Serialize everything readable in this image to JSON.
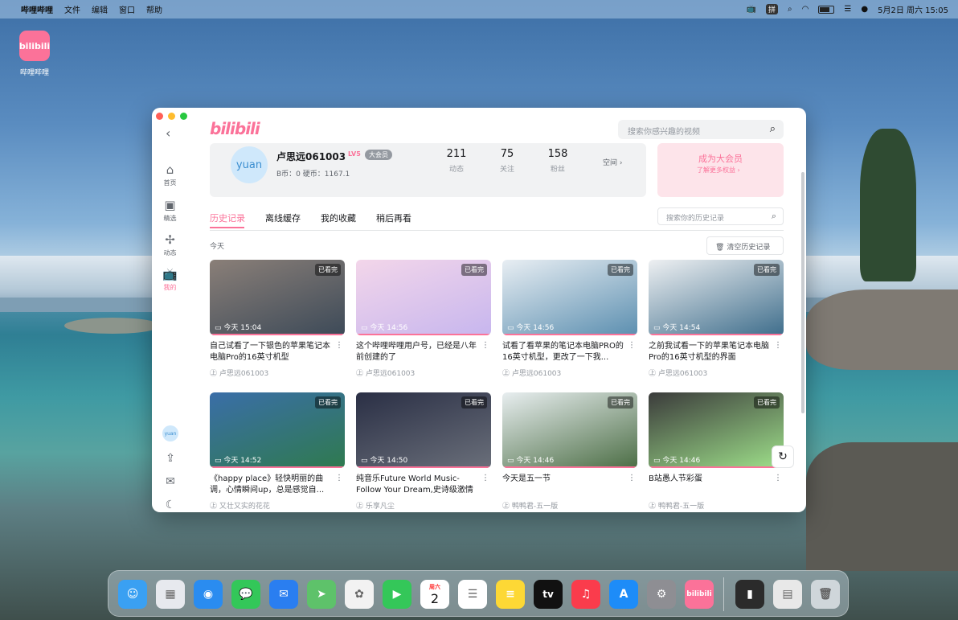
{
  "menubar": {
    "app": "哔哩哔哩",
    "items": [
      "文件",
      "编辑",
      "窗口",
      "帮助"
    ],
    "ime": "拼",
    "datetime": "5月2日 周六 15:05"
  },
  "desktop": {
    "icon_label": "哔哩哔哩",
    "icon_text": "bilibili"
  },
  "app": {
    "logo": "bilibili",
    "search_placeholder": "搜索你感兴趣的视频",
    "sidebar": [
      {
        "icon": "home-icon",
        "label": "首页"
      },
      {
        "icon": "bookmark-icon",
        "label": "精选"
      },
      {
        "icon": "pinwheel-icon",
        "label": "动态"
      },
      {
        "icon": "tv-icon",
        "label": "我的",
        "active": true
      }
    ],
    "sidebar_avatar": "yuan",
    "profile": {
      "avatar": "yuan",
      "name": "卢思远061003",
      "level": "LV5",
      "vip": "大会员",
      "coins": "B币：0   硬币：1167.1",
      "stats": [
        {
          "n": "211",
          "t": "动态"
        },
        {
          "n": "75",
          "t": "关注"
        },
        {
          "n": "158",
          "t": "粉丝"
        }
      ],
      "space": "空间 ›"
    },
    "vipcard": {
      "title": "成为大会员",
      "sub": "了解更多权益 ›"
    },
    "tabs": [
      "历史记录",
      "离线缓存",
      "我的收藏",
      "稍后再看"
    ],
    "history_search": "搜索你的历史记录",
    "today": "今天",
    "clear": "清空历史记录",
    "videos": [
      {
        "title": "自己试看了一下银色的苹果笔记本电脑Pro的16英寸机型",
        "author": "卢思远061003",
        "time": "今天 15:04",
        "watched": "已看完",
        "colors": [
          "#8a7f78",
          "#3d4a58"
        ]
      },
      {
        "title": "这个哔哩哔哩用户号，已经是八年前创建的了",
        "author": "卢思远061003",
        "time": "今天 14:56",
        "watched": "已看完",
        "colors": [
          "#f3d6ea",
          "#c7b6ee"
        ]
      },
      {
        "title": "试看了看苹果的笔记本电脑PRO的16英寸机型，更改了一下我...",
        "author": "卢思远061003",
        "time": "今天 14:56",
        "watched": "已看完",
        "colors": [
          "#e8eef3",
          "#5c8fb0"
        ]
      },
      {
        "title": "之前我试看一下的苹果笔记本电脑Pro的16英寸机型的界面",
        "author": "卢思远061003",
        "time": "今天 14:54",
        "watched": "已看完",
        "colors": [
          "#eef0f2",
          "#3f6e8c"
        ]
      },
      {
        "title": "《happy place》轻快明丽的曲调，心情瞬间up，总是感觉自...",
        "author": "又壮又实的花花",
        "time": "今天 14:52",
        "watched": "已看完",
        "colors": [
          "#3a6ea8",
          "#2f7a4f"
        ]
      },
      {
        "title": "纯音乐Future World Music-Follow Your Dream,史诗级激情震...",
        "author": "乐享凡尘",
        "time": "今天 14:50",
        "watched": "已看完",
        "colors": [
          "#2a2f45",
          "#6a6f7a"
        ]
      },
      {
        "title": "今天是五一节",
        "author": "鸭鸭君-五一版",
        "time": "今天 14:46",
        "watched": "已看完",
        "colors": [
          "#e8eef0",
          "#4c6e45"
        ]
      },
      {
        "title": "B站愚人节彩蛋",
        "author": "鸭鸭君-五一版",
        "time": "今天 14:46",
        "watched": "已看完",
        "colors": [
          "#3b3b3b",
          "#9ee08a"
        ]
      }
    ]
  },
  "dock": [
    "finder",
    "launchpad",
    "safari",
    "messages",
    "mail",
    "maps",
    "photos",
    "facetime",
    "calendar",
    "reminders",
    "notes",
    "tv",
    "music",
    "app-store",
    "settings",
    "bilibili",
    "terminal",
    "preview",
    "trash"
  ],
  "dock_labels": {
    "calendar_day": "周六",
    "calendar_date": "2",
    "tv": "tv",
    "bilibili": "bilibili"
  }
}
